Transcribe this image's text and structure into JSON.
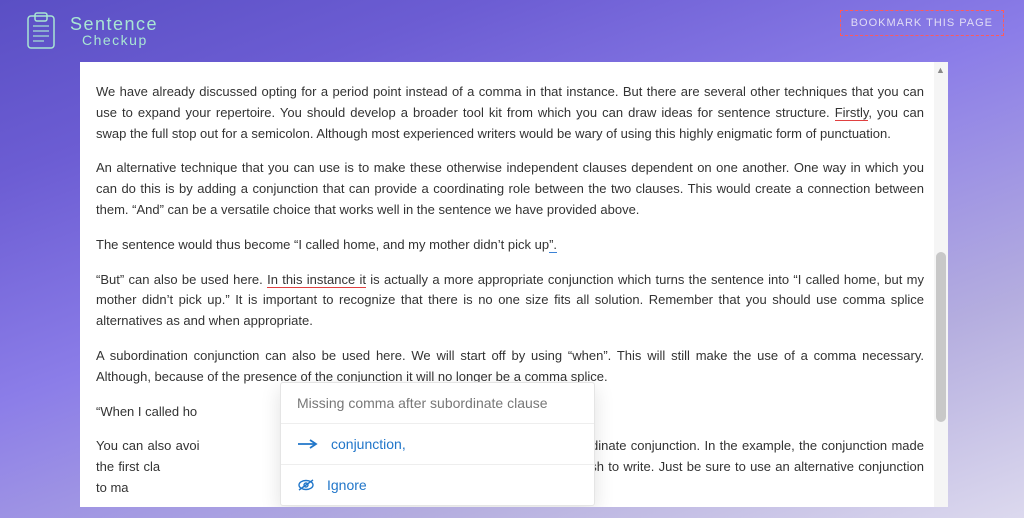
{
  "header": {
    "logo_top": "Sentence",
    "logo_bottom": "Checkup",
    "bookmark_label": "BOOKMARK THIS PAGE"
  },
  "content": {
    "p1_a": "We have already discussed opting for a period point instead of a comma in that instance. But there are several other techniques that you can use to expand your repertoire. You should develop a broader tool kit from which you can draw ideas for sentence structure. ",
    "p1_firstly": "Firstly",
    "p1_b": ", you can swap the full stop out for a semicolon. Although most experienced writers would be wary of using this highly enigmatic form of punctuation.",
    "p2": "An alternative technique that you can use is to make these otherwise independent clauses dependent on one another. One way in which you can do this is by adding a conjunction that can provide a coordinating role between the two clauses. This would create a connection between them. “And” can be a versatile choice that works well in the sentence we have provided above.",
    "p3_a": "The sentence would thus become “I called home, and my mother didn’t pick up",
    "p3_mark": "”.",
    "p4_a": "“But” can also be used here. ",
    "p4_underline": "In this instance it",
    "p4_b": " is actually a more appropriate conjunction which turns the sentence into “I called home, but my mother didn’t pick up.” It is important to recognize that there is no one size fits all solution. Remember that you should use comma splice alternatives as and when appropriate.",
    "p5_a": "A subordination conjunction can also be used here. We will start off by using “when”. This will still make the use of a comma necessary. Although, because of the presence of the ",
    "p5_conj": "conjunction",
    "p5_b": " it will no longer be a comma splice.",
    "p6": "“When I called ho",
    "p7_a": "You can also avoi",
    "p7_b": "ype of subordinate conjunction. In the example, the conjunction made the first cla",
    "p7_c": " if that is how we wish to write. Just be sure to use an alternative conjunction to ma"
  },
  "tooltip": {
    "title": "Missing comma after subordinate clause",
    "suggestion": "conjunction,",
    "ignore": "Ignore"
  }
}
